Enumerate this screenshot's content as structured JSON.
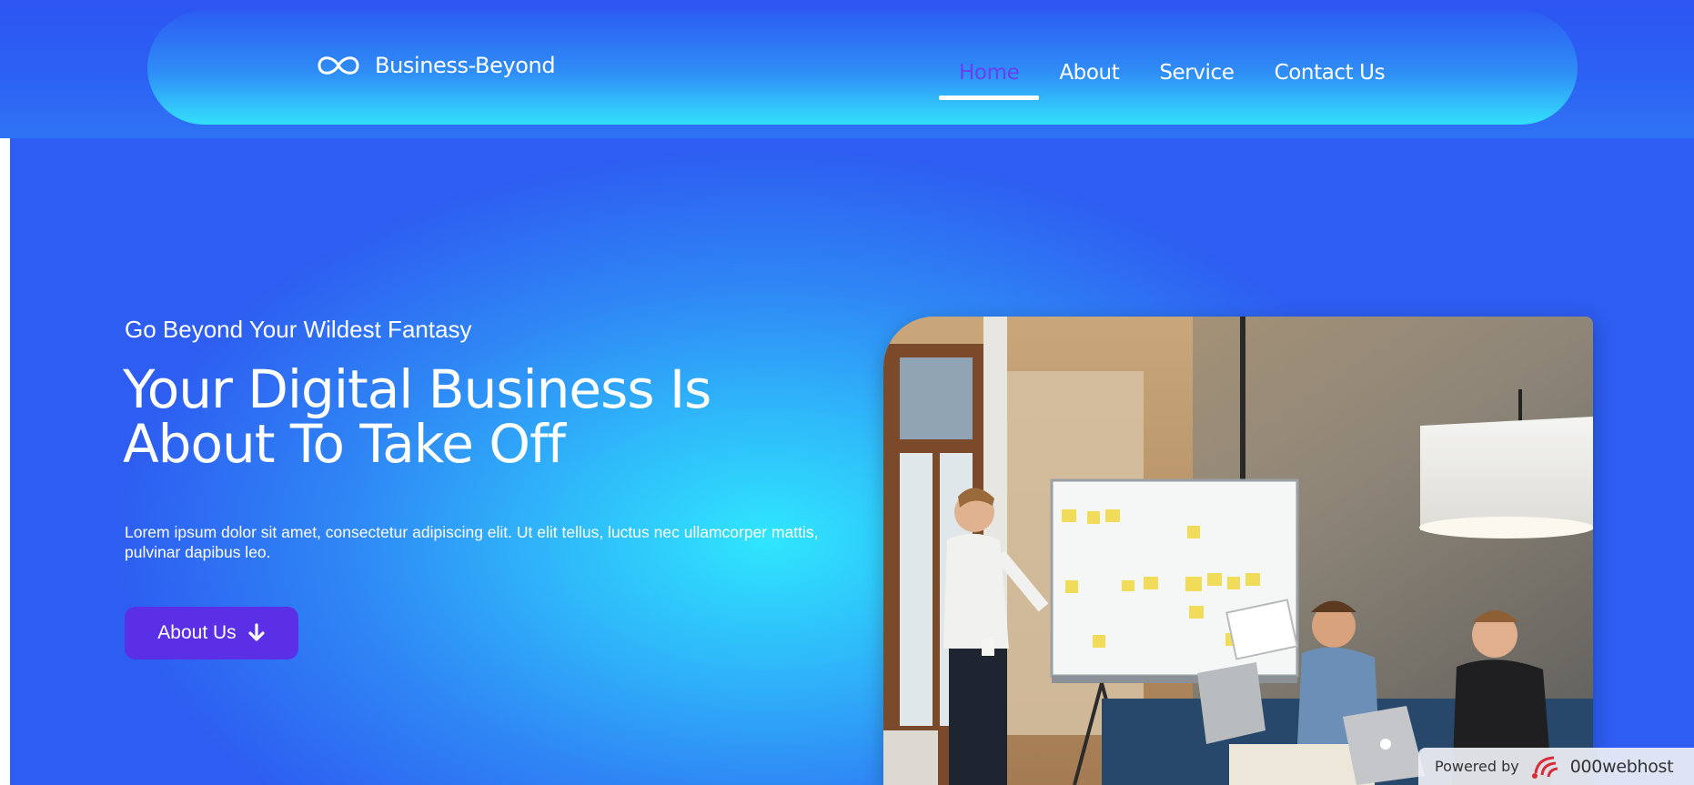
{
  "brand": {
    "name": "Business-Beyond",
    "icon": "infinity-icon"
  },
  "nav": {
    "items": [
      {
        "label": "Home",
        "active": true
      },
      {
        "label": "About",
        "active": false
      },
      {
        "label": "Service",
        "active": false
      },
      {
        "label": "Contact Us",
        "active": false
      }
    ]
  },
  "hero": {
    "eyebrow": "Go Beyond Your Wildest Fantasy",
    "title_line1": "Your Digital Business Is",
    "title_line2": "About To Take Off",
    "text": "Lorem ipsum dolor sit amet, consectetur adipiscing elit. Ut elit tellus, luctus nec ullamcorper mattis, pulvinar dapibus leo.",
    "button_label": "About Us",
    "button_icon": "arrow-down-icon"
  },
  "powered": {
    "prefix": "Powered by",
    "host": "000webhost",
    "logo": "000webhost-logo-icon"
  },
  "colors": {
    "header_band": "#2d55f2",
    "nav_gradient_top": "#2c5df2",
    "nav_gradient_bottom": "#33e0fb",
    "active_nav": "#6a3ff0",
    "button": "#5b2fe6",
    "hero_center": "#2fe6fd",
    "hero_edge": "#2d5df1"
  }
}
